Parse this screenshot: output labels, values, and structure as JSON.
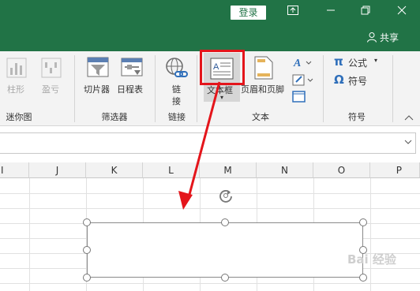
{
  "titlebar": {
    "login_label": "登录",
    "share_label": "共享",
    "window_icons": [
      "ribbon-display-icon",
      "minimize-icon",
      "restore-icon",
      "close-icon"
    ]
  },
  "ribbon": {
    "sparklines": {
      "buttons": [
        {
          "label": "柱形",
          "icon": "column-sparkline-icon"
        },
        {
          "label": "盈亏",
          "icon": "win-loss-sparkline-icon"
        }
      ],
      "group_label": "迷你图"
    },
    "filters": {
      "buttons": [
        {
          "label": "切片器",
          "icon": "slicer-icon"
        },
        {
          "label": "日程表",
          "icon": "timeline-icon"
        }
      ],
      "group_label": "筛选器"
    },
    "links": {
      "buttons": [
        {
          "label_line1": "链",
          "label_line2": "接",
          "icon": "link-icon"
        }
      ],
      "group_label": "链接"
    },
    "text": {
      "buttons": [
        {
          "label": "文本框",
          "icon": "textbox-icon"
        },
        {
          "label": "页眉和页脚",
          "icon": "header-footer-icon"
        }
      ],
      "small_icons": [
        "wordart-icon",
        "signature-line-icon",
        "object-icon"
      ],
      "group_label": "文本"
    },
    "symbols": {
      "formula_label": "公式",
      "formula_glyph": "π",
      "symbol_label": "符号",
      "symbol_glyph": "Ω",
      "group_label": "符号"
    },
    "highlight_color": "#e4151b"
  },
  "grid": {
    "columns": [
      "I",
      "J",
      "K",
      "L",
      "M",
      "N",
      "O",
      "P"
    ]
  },
  "watermark": "Bai 经验",
  "colors": {
    "accent": "#217346",
    "annotation": "#e4151b"
  }
}
